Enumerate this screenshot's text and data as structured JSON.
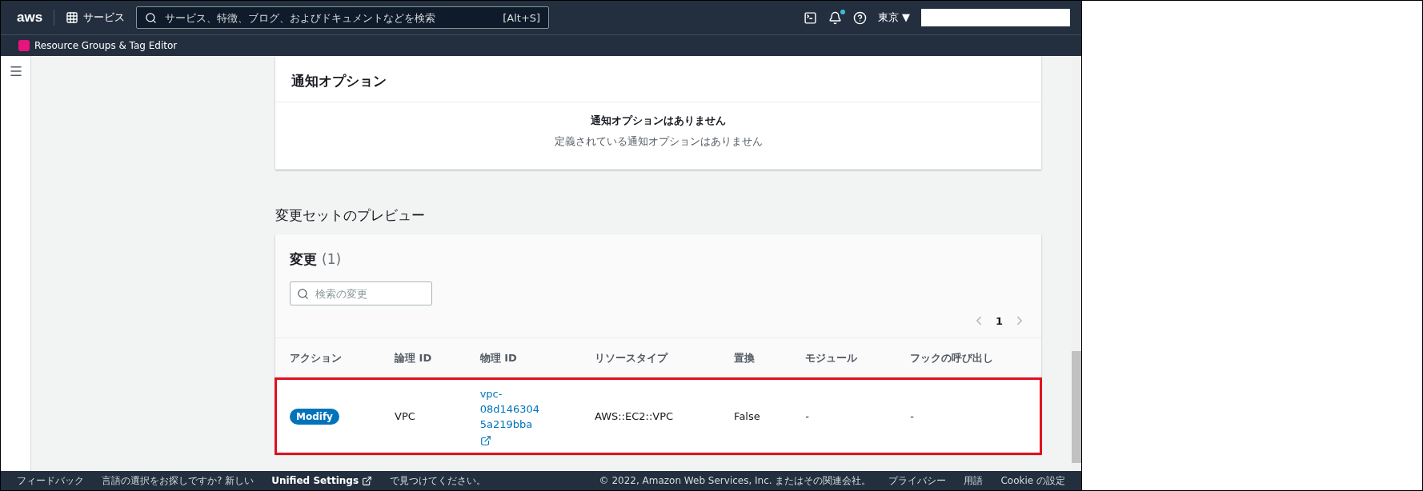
{
  "top_nav": {
    "logo": "aws",
    "services": "サービス",
    "search_placeholder": "サービス、特徴、ブログ、およびドキュメントなどを検索",
    "search_shortcut": "[Alt+S]",
    "notification_badge": true,
    "region": "東京 ▼"
  },
  "service_bar": {
    "label": "Resource Groups & Tag Editor"
  },
  "notification_card": {
    "title": "通知オプション",
    "empty_title": "通知オプションはありません",
    "empty_text": "定義されている通知オプションはありません"
  },
  "preview": {
    "heading": "変更セットのプレビュー",
    "title": "変更",
    "count": "(1)",
    "search_placeholder": "検索の変更",
    "page": "1",
    "columns": [
      "アクション",
      "論理 ID",
      "物理 ID",
      "リソースタイプ",
      "置換",
      "モジュール",
      "フックの呼び出し"
    ],
    "rows": [
      {
        "action": "Modify",
        "logical_id": "VPC",
        "physical_id": [
          "vpc-",
          "08d146304",
          "5a219bba"
        ],
        "resource_type": "AWS::EC2::VPC",
        "replacement": "False",
        "module": "-",
        "hook": "-",
        "highlighted": true
      }
    ]
  },
  "footer": {
    "feedback": "フィードバック",
    "language_prompt": "言語の選択をお探しですか? 新しい",
    "unified_settings": "Unified Settings",
    "language_suffix": "で見つけてください。",
    "copyright": "© 2022, Amazon Web Services, Inc. またはその関連会社。",
    "links": [
      "プライバシー",
      "用語",
      "Cookie の設定"
    ]
  }
}
